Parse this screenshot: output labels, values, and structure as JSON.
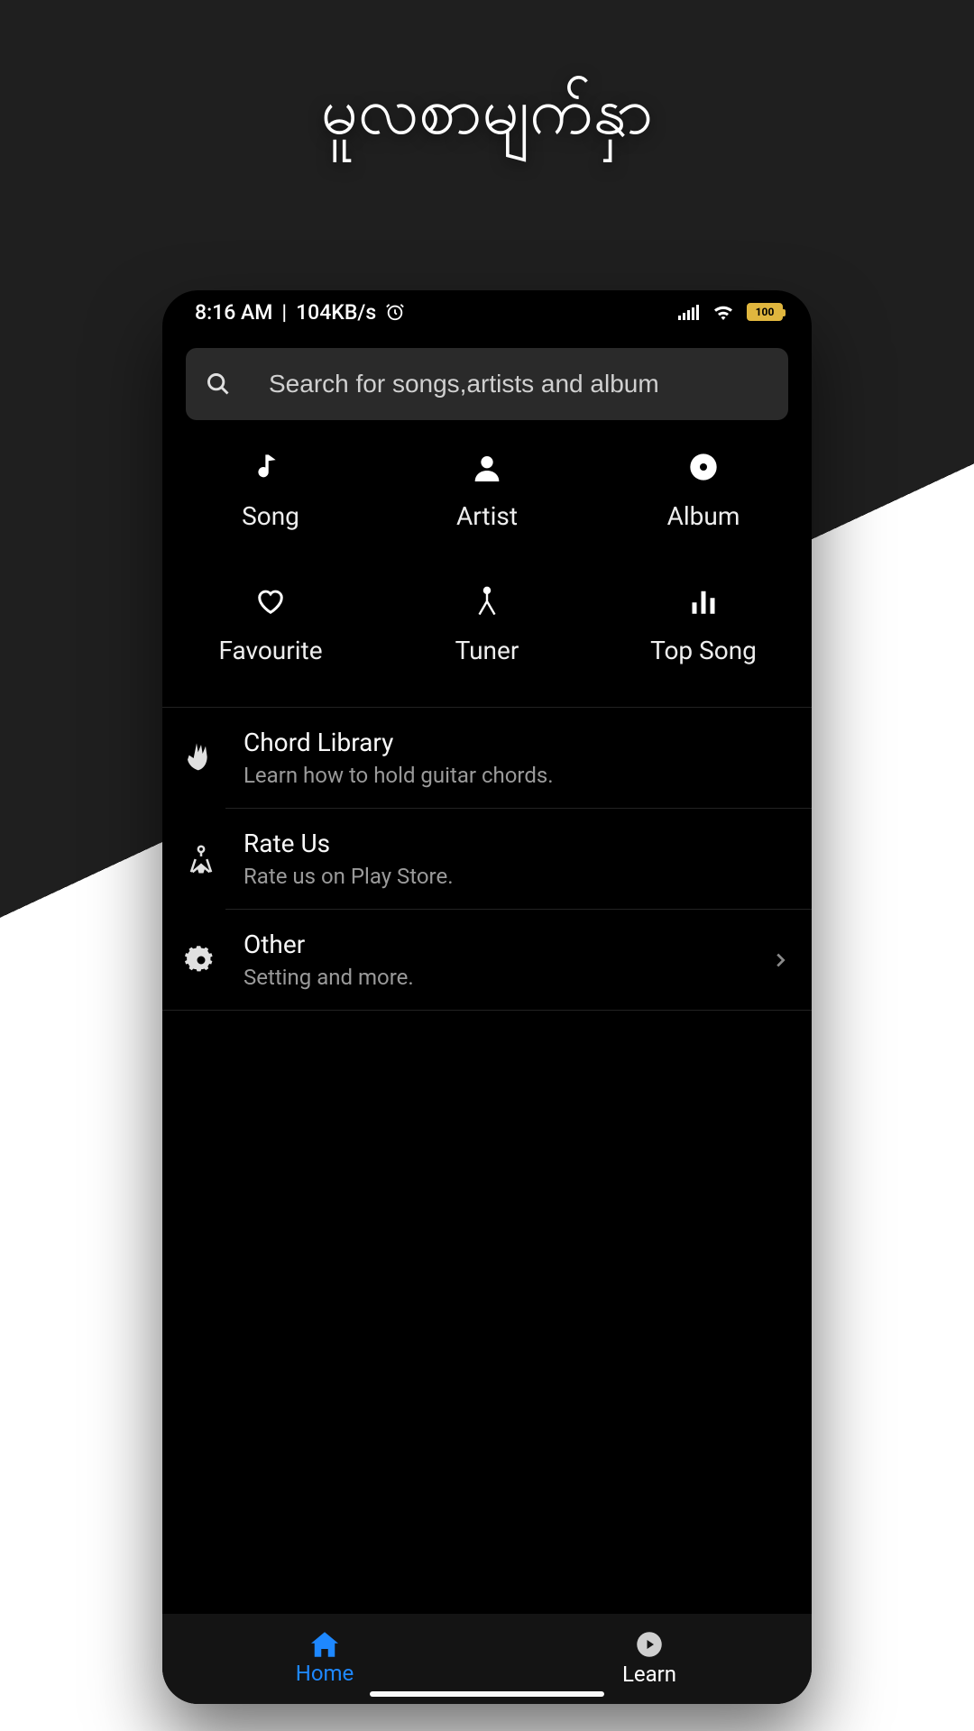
{
  "page": {
    "title": "မူလစာမျက်နှာ"
  },
  "status": {
    "time": "8:16 AM",
    "network_speed": "104KB/s",
    "battery_text": "100"
  },
  "search": {
    "placeholder": "Search for songs,artists and album"
  },
  "categories": [
    {
      "icon": "music-note-icon",
      "label": "Song"
    },
    {
      "icon": "person-icon",
      "label": "Artist"
    },
    {
      "icon": "album-icon",
      "label": "Album"
    },
    {
      "icon": "heart-icon",
      "label": "Favourite"
    },
    {
      "icon": "tuner-icon",
      "label": "Tuner"
    },
    {
      "icon": "bars-icon",
      "label": "Top Song"
    }
  ],
  "menu": [
    {
      "icon": "hand-icon",
      "title": "Chord Library",
      "subtitle": "Learn how to hold guitar chords.",
      "chevron": false
    },
    {
      "icon": "rate-icon",
      "title": "Rate Us",
      "subtitle": "Rate us on Play Store.",
      "chevron": false
    },
    {
      "icon": "gear-icon",
      "title": "Other",
      "subtitle": "Setting and more.",
      "chevron": true
    }
  ],
  "bottom_nav": {
    "home": "Home",
    "learn": "Learn"
  },
  "colors": {
    "accent": "#1e88ff",
    "battery": "#e0b63e"
  }
}
